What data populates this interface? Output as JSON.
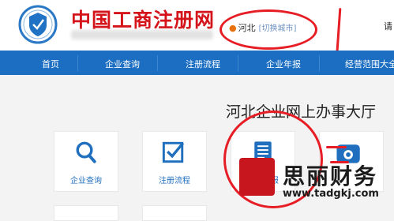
{
  "header": {
    "brand": "中国工商注册网",
    "city": {
      "name": "河北",
      "switch_label": "[切换城市]"
    },
    "login_label": "请"
  },
  "nav": {
    "items": [
      {
        "label": "首页"
      },
      {
        "label": "企业查询"
      },
      {
        "label": "注册流程"
      },
      {
        "label": "企业年报"
      },
      {
        "label": "经营范围大全"
      }
    ]
  },
  "main": {
    "title": "河北企业网上办事大厅",
    "cards": [
      {
        "label": "企业查询",
        "icon": "magnifier-icon"
      },
      {
        "label": "注册流程",
        "icon": "checkbox-icon"
      },
      {
        "label": "企业年报",
        "icon": "document-icon"
      },
      {
        "label": "",
        "icon": "phone-icon"
      }
    ]
  },
  "watermark": {
    "name": "思丽财务",
    "url": "www.tadgkj.com"
  },
  "colors": {
    "nav_blue": "#1b6ec2",
    "brand_red": "#d4141a",
    "annotation_red": "#e61d24"
  }
}
